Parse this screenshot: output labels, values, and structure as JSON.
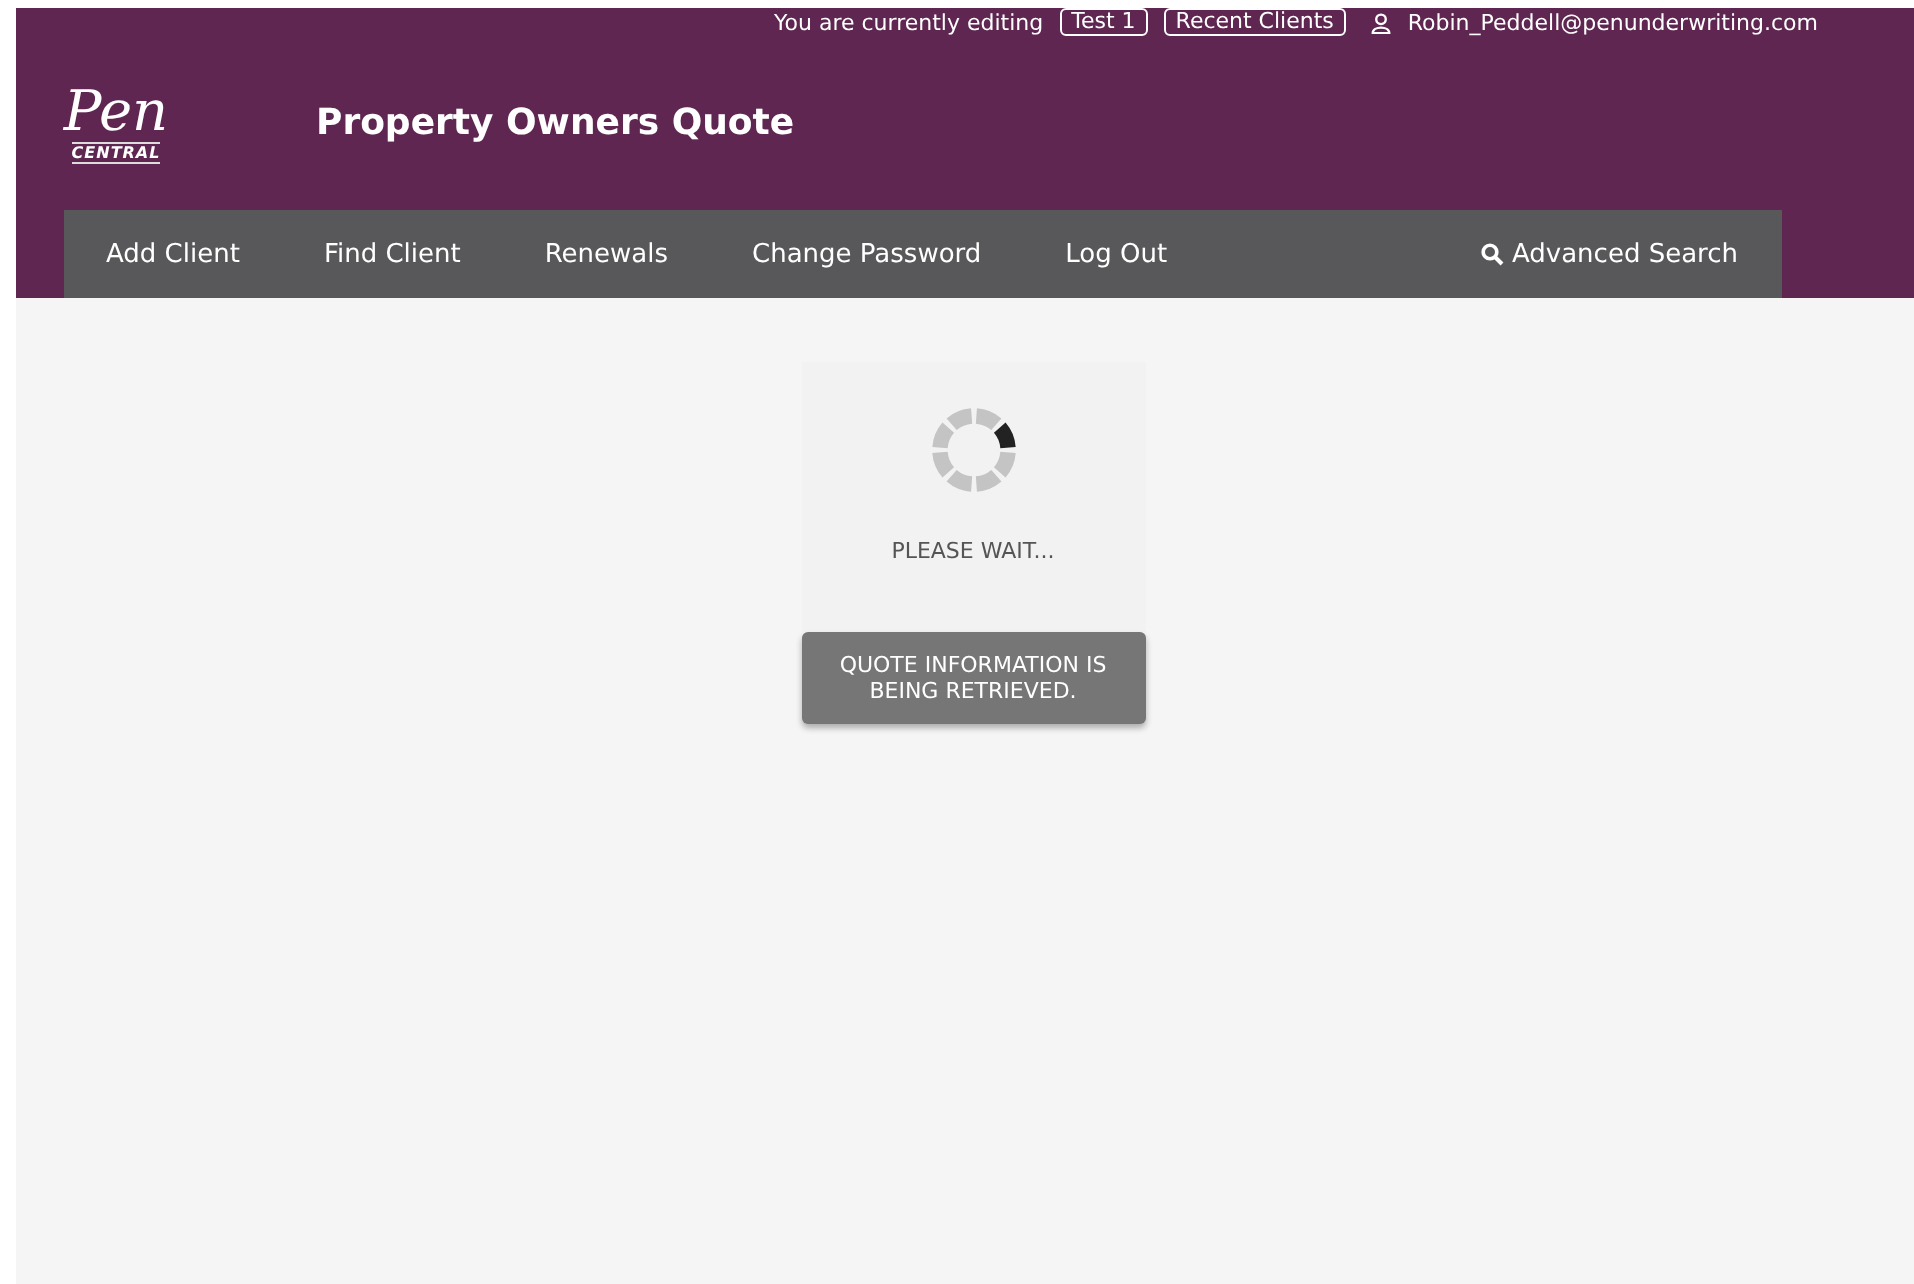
{
  "top_bar": {
    "editing_label": "You are currently editing",
    "client_badge": "Test 1",
    "recent_clients": "Recent Clients",
    "user_email": "Robin_Peddell@penunderwriting.com"
  },
  "logo": {
    "script": "Pen",
    "sub": "CENTRAL"
  },
  "page_title": "Property Owners Quote",
  "nav": {
    "items": [
      {
        "label": "Add Client"
      },
      {
        "label": "Find Client"
      },
      {
        "label": "Renewals"
      },
      {
        "label": "Change Password"
      },
      {
        "label": "Log Out"
      }
    ],
    "search_link": "Advanced Search"
  },
  "loader": {
    "label": "PLEASE WAIT...",
    "message": "QUOTE INFORMATION IS BEING RETRIEVED."
  }
}
